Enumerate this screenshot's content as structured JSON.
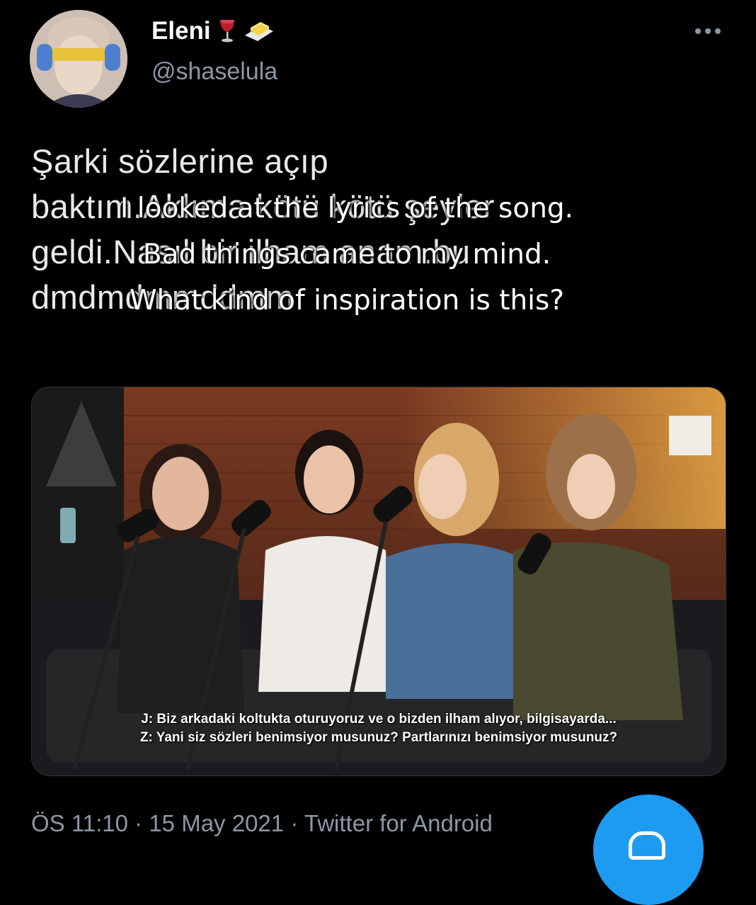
{
  "tweet": {
    "author": {
      "display_name": "Eleni",
      "handle": "@shaselula",
      "name_emojis": [
        "wine-glass-icon",
        "butter-icon"
      ]
    },
    "text": "Şarki sözlerine açıp\nbaktım.Aklıma kötü kötü şeyler\ngeldi.Nasıl bir ilham anam.bu\ndmdmdmmddmm",
    "translation_overlay": [
      "I looked at the lyrics of the song.",
      "Bad things came to my mind.",
      "What kind of inspiration is this?"
    ],
    "media": {
      "subtitles": [
        "J: Biz arkadaki koltukta oturuyoruz ve o bizden ilham alıyor, bilgisayarda...",
        "Z: Yani siz sözleri benimsiyor musunuz? Partlarınızı benimsiyor musunuz?"
      ]
    },
    "meta": {
      "time": "ÖS 11:10",
      "date": "15 May 2021",
      "source": "Twitter for Android",
      "separator": "·"
    }
  },
  "colors": {
    "background": "#000000",
    "text": "#e7e9ea",
    "secondary": "#8b98a5",
    "accent": "#1d9bf0"
  },
  "fab": {
    "icon": "compose-icon"
  }
}
